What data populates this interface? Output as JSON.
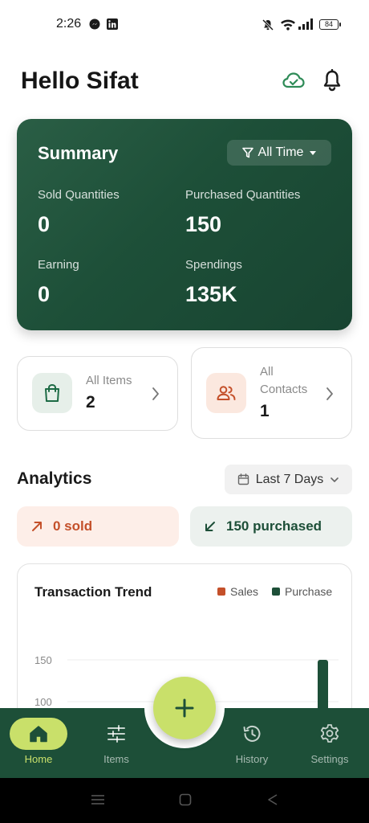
{
  "status_bar": {
    "time": "2:26",
    "battery": "84"
  },
  "header": {
    "greeting": "Hello Sifat",
    "cloud_icon": "cloud-sync-icon",
    "bell_icon": "bell-icon"
  },
  "summary": {
    "title": "Summary",
    "filter_label": "All Time",
    "sold_label": "Sold Quantities",
    "sold_value": "0",
    "purchased_label": "Purchased Quantities",
    "purchased_value": "150",
    "earning_label": "Earning",
    "earning_value": "0",
    "spendings_label": "Spendings",
    "spendings_value": "135K"
  },
  "cards": {
    "items_label": "All Items",
    "items_value": "2",
    "contacts_label_1": "All",
    "contacts_label_2": "Contacts",
    "contacts_value": "1"
  },
  "analytics": {
    "title": "Analytics",
    "range_label": "Last 7 Days",
    "sold_pill": "0 sold",
    "purchased_pill": "150 purchased"
  },
  "colors": {
    "primary": "#1d4f38",
    "accent": "#c9e06a",
    "sales": "#c4502a",
    "purchase": "#1d4f38"
  },
  "chart_data": {
    "type": "bar",
    "title": "Transaction Trend",
    "series": [
      {
        "name": "Sales",
        "color": "#c4502a",
        "values": [
          0
        ]
      },
      {
        "name": "Purchase",
        "color": "#1d4f38",
        "values": [
          150
        ]
      }
    ],
    "y_ticks": [
      "150",
      "100"
    ],
    "ylim_visible": [
      100,
      150
    ],
    "legend_position": "top-right"
  },
  "nav": {
    "items": [
      {
        "label": "Home",
        "icon": "home-icon"
      },
      {
        "label": "Items",
        "icon": "sliders-icon"
      },
      {
        "label": "History",
        "icon": "history-icon"
      },
      {
        "label": "Settings",
        "icon": "gear-icon"
      }
    ],
    "fab_icon": "plus-icon"
  }
}
